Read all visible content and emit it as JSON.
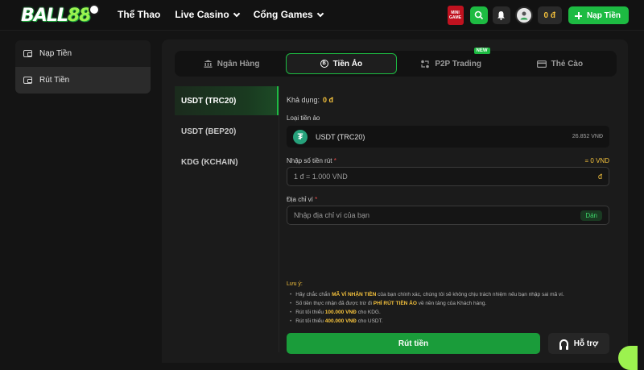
{
  "header": {
    "logo": {
      "text": "BALL",
      "num": "88"
    },
    "nav": [
      {
        "label": "Thể Thao",
        "dropdown": false
      },
      {
        "label": "Live Casino",
        "dropdown": true
      },
      {
        "label": "Cổng Games",
        "dropdown": true
      }
    ],
    "mini_game": {
      "line1": "MINI",
      "line2": "GAME"
    },
    "balance": "0 đ",
    "deposit_label": "Nạp Tiền"
  },
  "sidebar": {
    "items": [
      {
        "label": "Nạp Tiền",
        "active": false
      },
      {
        "label": "Rút Tiền",
        "active": true
      }
    ]
  },
  "tabs": [
    {
      "label": "Ngân Hàng",
      "icon": "bank-icon",
      "active": false
    },
    {
      "label": "Tiền Ảo",
      "icon": "crypto-icon",
      "active": true
    },
    {
      "label": "P2P Trading",
      "icon": "p2p-icon",
      "active": false,
      "badge": "NEW"
    },
    {
      "label": "Thẻ Cào",
      "icon": "card-icon",
      "active": false
    }
  ],
  "coins": [
    {
      "label": "USDT (TRC20)",
      "active": true
    },
    {
      "label": "USDT (BEP20)",
      "active": false
    },
    {
      "label": "KDG (KCHAIN)",
      "active": false
    }
  ],
  "form": {
    "available_label": "Khả dụng:",
    "available_value": "0 đ",
    "coin_type_label": "Loại tiền ảo",
    "coin_selected": "USDT (TRC20)",
    "coin_rate": "26.852 VNĐ",
    "amount_label": "Nhập số tiền rút",
    "amount_equiv": "= 0 VND",
    "amount_placeholder": "1 đ = 1.000 VND",
    "amount_unit": "đ",
    "address_label": "Địa chỉ ví",
    "address_placeholder": "Nhập địa chỉ ví của bạn",
    "paste_label": "Dán",
    "notes_title": "Lưu ý:",
    "notes": [
      {
        "pre": "Hãy chắc chắn ",
        "hl": "MÃ VÍ NHẬN TIỀN",
        "post": " của bạn chính xác, chúng tôi sẽ không chịu trách nhiệm nếu bạn nhập sai mã ví."
      },
      {
        "pre": "Số tiền thực nhận đã được trừ đi ",
        "hl": "PHÍ RÚT TIỀN ẢO",
        "post": " về nền tảng của Khách hàng."
      },
      {
        "pre": "Rút tối thiểu ",
        "hl": "100.000 VNĐ",
        "post": " cho KDG."
      },
      {
        "pre": "Rút tối thiểu ",
        "hl": "400.000 VNĐ",
        "post": " cho USDT."
      }
    ],
    "submit_label": "Rút tiền",
    "support_label": "Hỗ trợ"
  }
}
